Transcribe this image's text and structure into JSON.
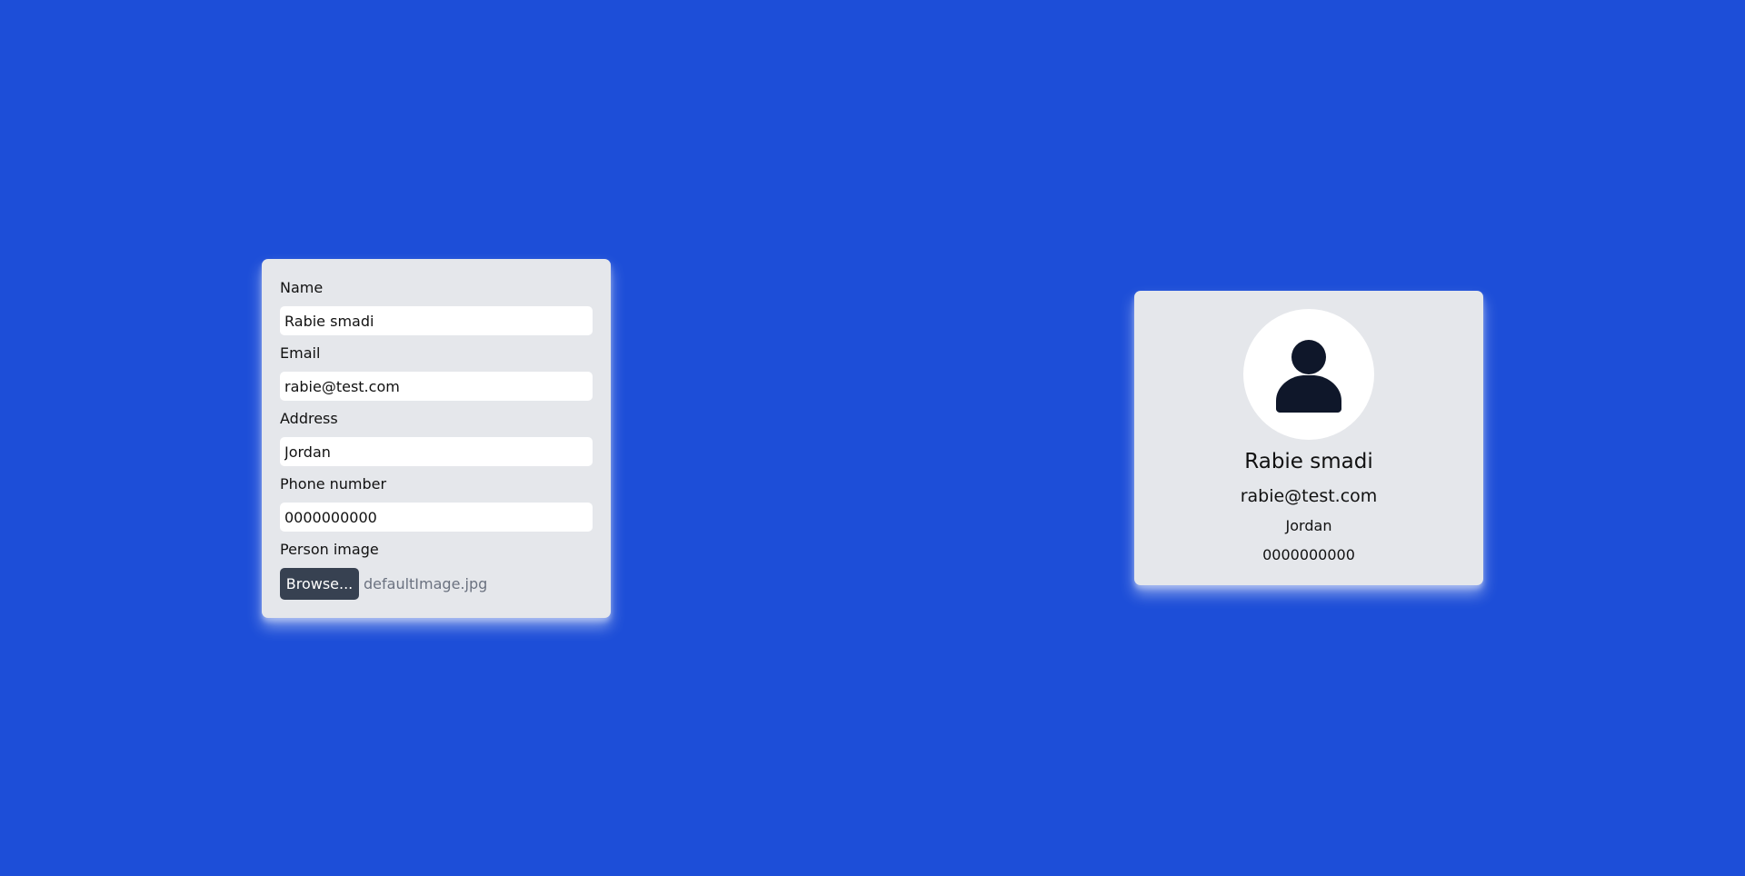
{
  "form": {
    "name_label": "Name",
    "name_value": "Rabie smadi",
    "email_label": "Email",
    "email_value": "rabie@test.com",
    "address_label": "Address",
    "address_value": "Jordan",
    "phone_label": "Phone number",
    "phone_value": "0000000000",
    "image_label": "Person image",
    "browse_label": "Browse...",
    "file_name": "defaultImage.jpg"
  },
  "profile": {
    "avatar_icon": "person-icon",
    "name": "Rabie smadi",
    "email": "rabie@test.com",
    "address": "Jordan",
    "phone": "0000000000"
  },
  "colors": {
    "background": "#1d4ed8",
    "card": "#e5e7eb",
    "button": "#374151",
    "icon": "#0f172a"
  }
}
